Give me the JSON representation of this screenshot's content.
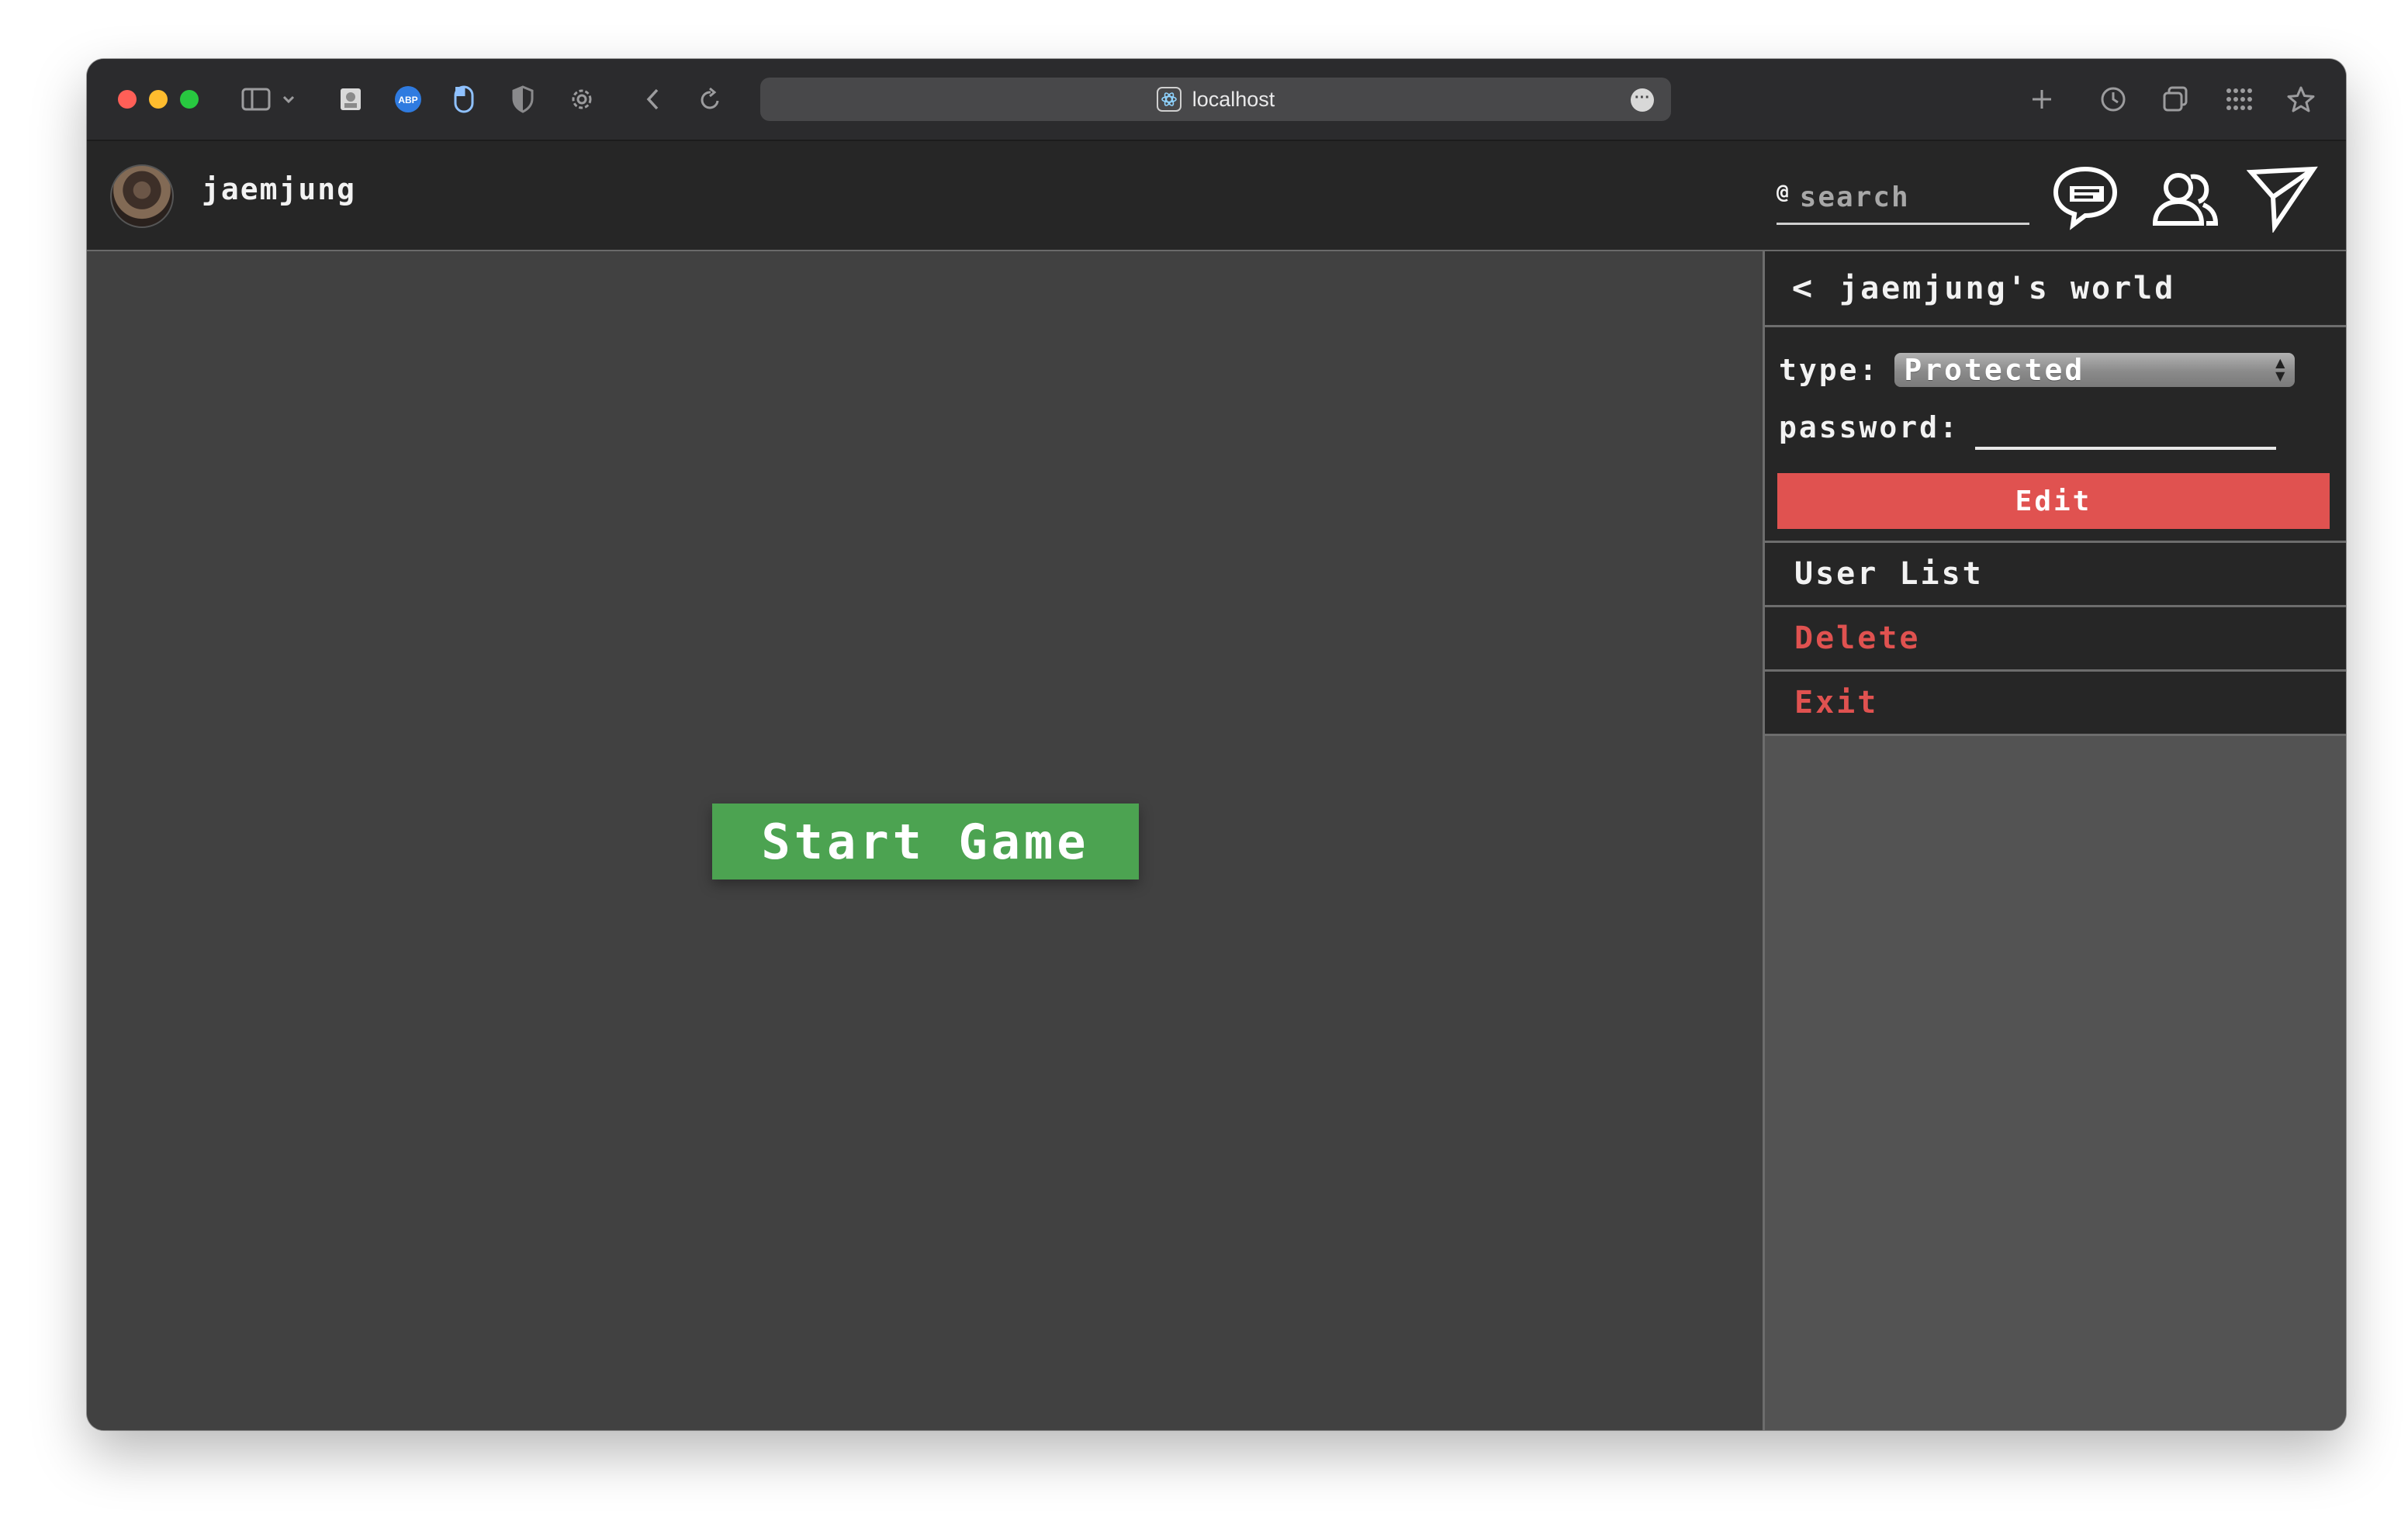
{
  "browser": {
    "url": "localhost"
  },
  "header": {
    "username": "jaemjung",
    "search_placeholder": "search",
    "search_prefix": "@"
  },
  "game": {
    "start_label": "Start Game"
  },
  "panel": {
    "back_glyph": "<",
    "title": "jaemjung's world",
    "type_label": "type:",
    "type_value": "Protected",
    "password_label": "password:",
    "edit_label": "Edit",
    "user_list_label": "User List",
    "delete_label": "Delete",
    "exit_label": "Exit"
  },
  "colors": {
    "start_button": "#4ca351",
    "danger": "#e05250",
    "header_bg": "#262626",
    "game_bg": "#414141",
    "panel_bg": "#535353"
  },
  "icons": [
    "sidebar-icon",
    "chevron-down-icon",
    "profile-extension-icon",
    "adblock-icon",
    "mouse-icon",
    "shield-icon",
    "gear-icon",
    "back-icon",
    "reload-icon",
    "more-icon",
    "plus-icon",
    "history-icon",
    "tabs-icon",
    "grid-icon",
    "star-icon",
    "chat-icon",
    "friends-icon",
    "send-icon"
  ]
}
